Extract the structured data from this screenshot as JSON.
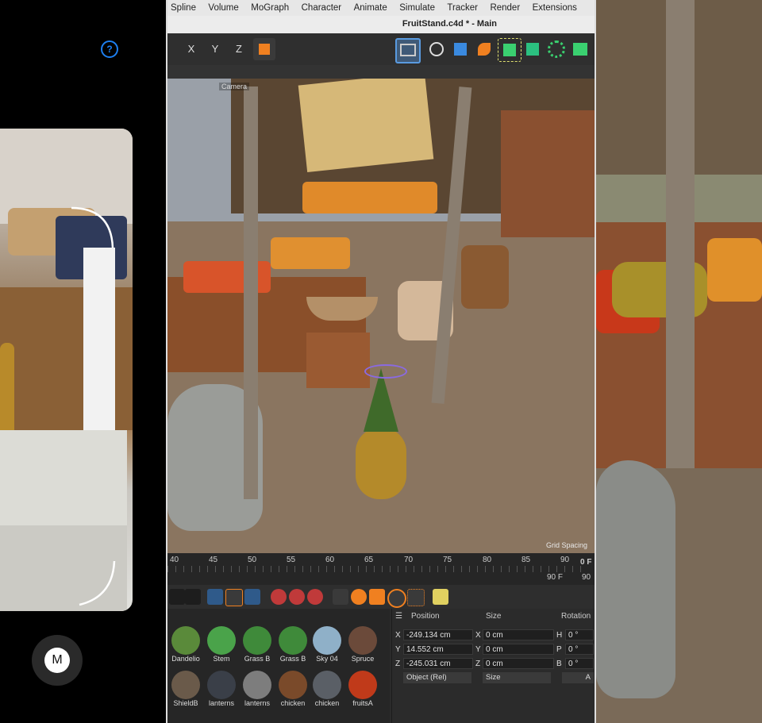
{
  "phone": {
    "help_icon_label": "?",
    "record_button_label": "M"
  },
  "app": {
    "menu": [
      "Spline",
      "Volume",
      "MoGraph",
      "Character",
      "Animate",
      "Simulate",
      "Tracker",
      "Render",
      "Extensions"
    ],
    "window_title": "FruitStand.c4d * - Main",
    "toolbar_left": [
      "X",
      "Y",
      "Z"
    ],
    "viewport": {
      "camera_label": "Camera",
      "grid_label": "Grid Spacing"
    },
    "timeline": {
      "ticks": [
        "40",
        "45",
        "50",
        "55",
        "60",
        "65",
        "70",
        "75",
        "80",
        "85",
        "90"
      ],
      "end_frame_label": "0 F",
      "current_frame": "90 F",
      "right_value": "90"
    },
    "materials": [
      {
        "name": "Dandelio",
        "color": "#5a8a3a"
      },
      {
        "name": "Stem",
        "color": "#4aa34a"
      },
      {
        "name": "Grass B",
        "color": "#3f8a3a"
      },
      {
        "name": "Grass B",
        "color": "#3f8a3a"
      },
      {
        "name": "Sky 04",
        "color": "#8fb0c8"
      },
      {
        "name": "Spruce",
        "color": "#6b4a3a"
      },
      {
        "name": "ShieldB",
        "color": "#6a5a4a"
      },
      {
        "name": "lanterns",
        "color": "#3a3f48"
      },
      {
        "name": "lanterns",
        "color": "#7d7d7d"
      },
      {
        "name": "chicken",
        "color": "#7a4a2a"
      },
      {
        "name": "chicken",
        "color": "#5a5f66"
      },
      {
        "name": "fruitsA",
        "color": "#c03a1a"
      }
    ],
    "attributes": {
      "headers": {
        "position": "Position",
        "size": "Size",
        "rotation": "Rotation"
      },
      "rows": [
        {
          "axis": "X",
          "pos": "-249.134 cm",
          "size_axis": "X",
          "size": "0 cm",
          "rot_axis": "H",
          "rot": "0 °"
        },
        {
          "axis": "Y",
          "pos": "14.552 cm",
          "size_axis": "Y",
          "size": "0 cm",
          "rot_axis": "P",
          "rot": "0 °"
        },
        {
          "axis": "Z",
          "pos": "-245.031 cm",
          "size_axis": "Z",
          "size": "0 cm",
          "rot_axis": "B",
          "rot": "0 °"
        }
      ],
      "coord_mode": "Object (Rel)",
      "size_mode": "Size",
      "apply_label": "A"
    }
  },
  "colors": {
    "accent_blue": "#1d7ff0",
    "icon_orange": "#f08020",
    "icon_green": "#3ad070"
  }
}
